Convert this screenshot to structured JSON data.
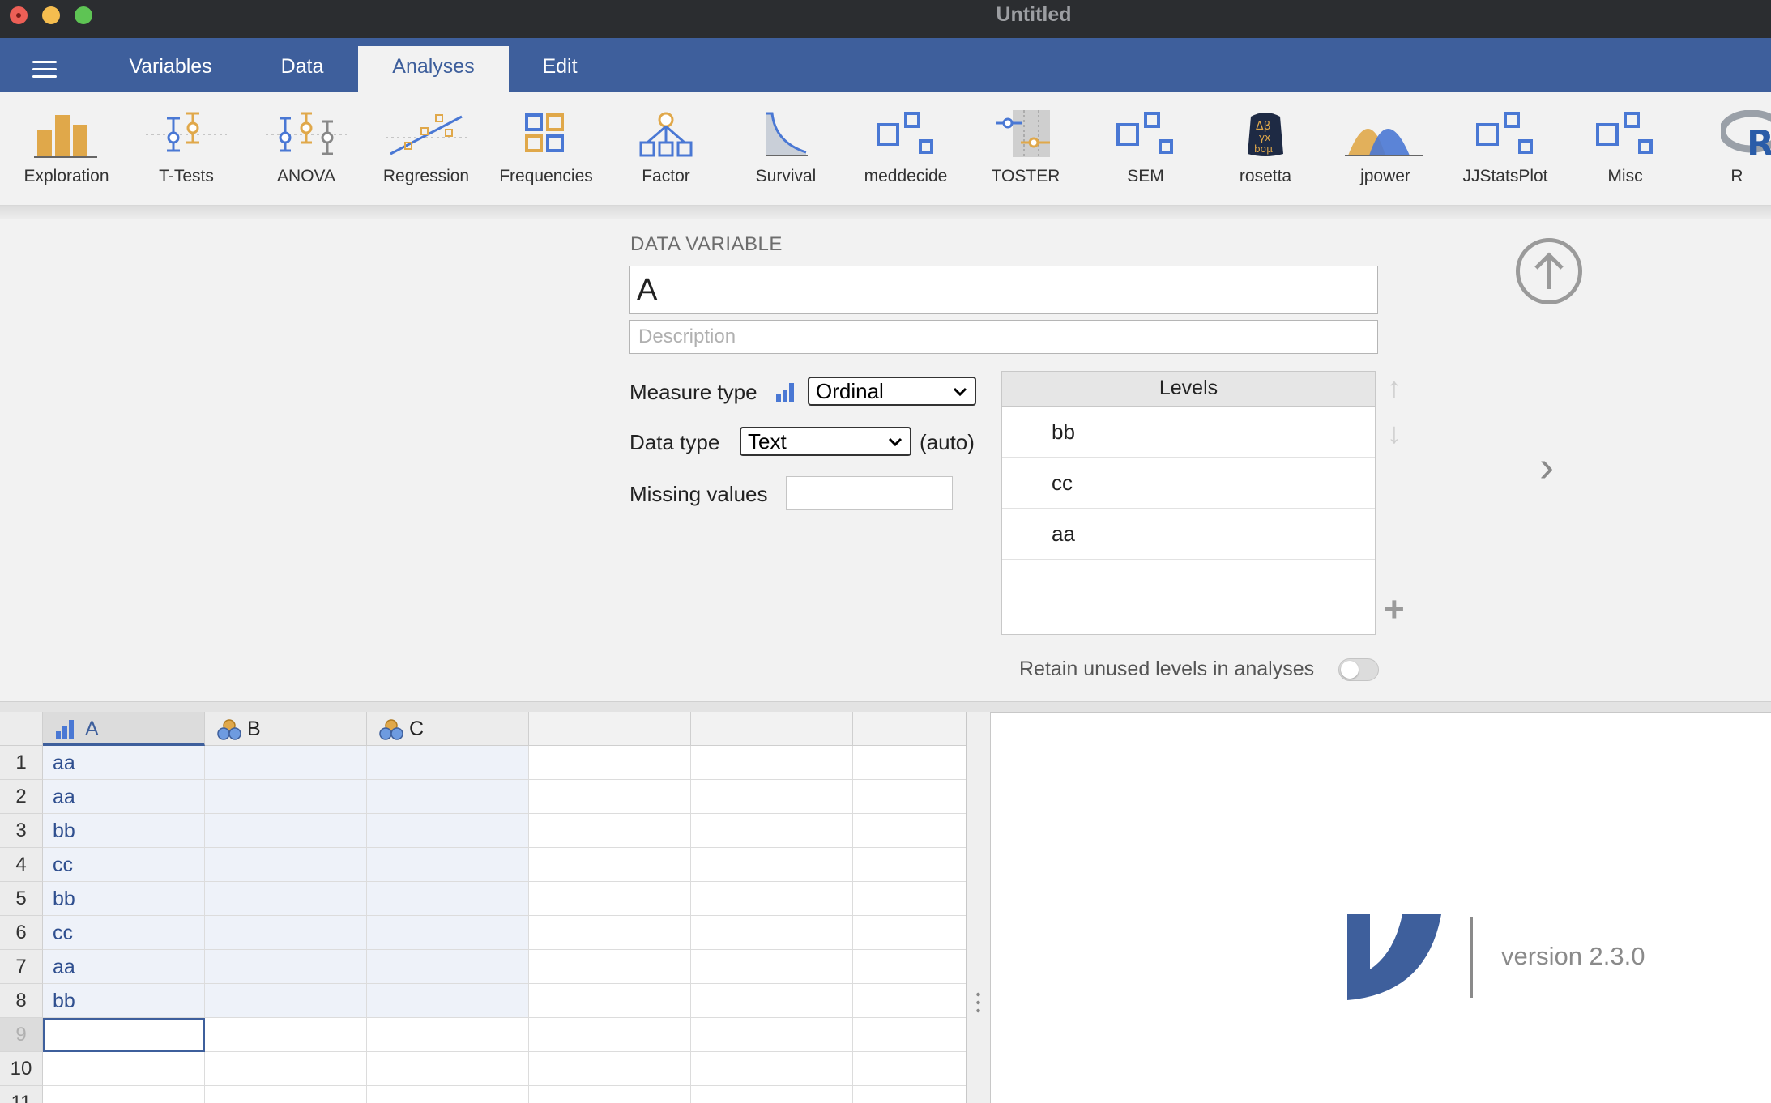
{
  "window": {
    "title": "Untitled"
  },
  "menu": {
    "tabs": [
      "Variables",
      "Data",
      "Analyses",
      "Edit"
    ],
    "active_tab": "Analyses"
  },
  "ribbon": {
    "tools": [
      "Exploration",
      "T-Tests",
      "ANOVA",
      "Regression",
      "Frequencies",
      "Factor",
      "Survival",
      "meddecide",
      "TOSTER",
      "SEM",
      "rosetta",
      "jpower",
      "JJStatsPlot",
      "Misc",
      "R"
    ]
  },
  "variable_editor": {
    "heading": "DATA VARIABLE",
    "name": "A",
    "description_placeholder": "Description",
    "measure_type_label": "Measure type",
    "measure_type_value": "Ordinal",
    "data_type_label": "Data type",
    "data_type_value": "Text",
    "data_type_auto": "(auto)",
    "missing_values_label": "Missing values",
    "missing_values_value": "",
    "levels_header": "Levels",
    "levels": [
      "bb",
      "cc",
      "aa"
    ],
    "retain_label": "Retain unused levels in analyses",
    "retain_enabled": false
  },
  "spreadsheet": {
    "columns": [
      {
        "name": "A",
        "type": "ordinal"
      },
      {
        "name": "B",
        "type": "nominal"
      },
      {
        "name": "C",
        "type": "nominal"
      }
    ],
    "row_numbers": [
      "1",
      "2",
      "3",
      "4",
      "5",
      "6",
      "7",
      "8",
      "9",
      "10",
      "11"
    ],
    "column_a_values": [
      "aa",
      "aa",
      "bb",
      "cc",
      "bb",
      "cc",
      "aa",
      "bb"
    ],
    "selected_row": "9"
  },
  "results": {
    "version": "version 2.3.0"
  },
  "colors": {
    "accent": "#3e5f9c",
    "ribbon_orange": "#e0a84a",
    "ribbon_blue": "#4a78d4"
  }
}
